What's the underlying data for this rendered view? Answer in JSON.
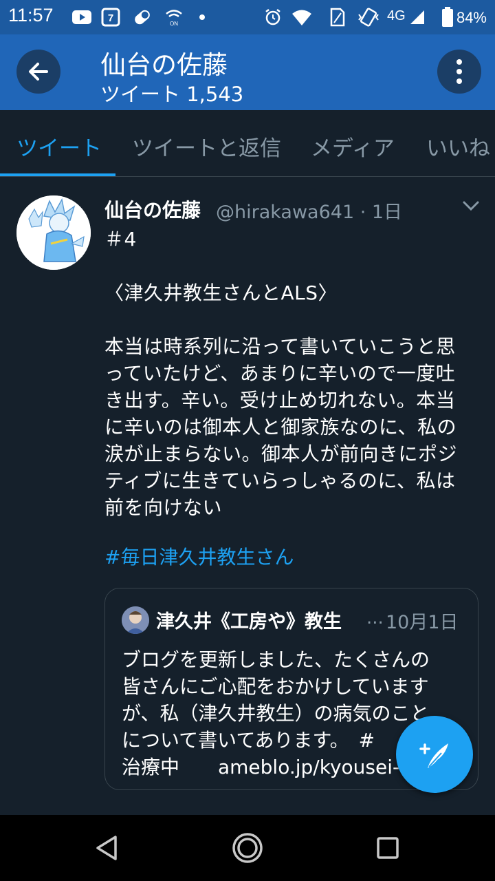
{
  "status_bar": {
    "time": "11:57",
    "network": "4G",
    "battery": "84%",
    "icons": [
      "youtube-icon",
      "seven-eleven-icon",
      "pill-icon",
      "wifi-on-icon",
      "dot-icon",
      "alarm-icon",
      "wifi-icon",
      "sim-icon",
      "vibrate-icon",
      "signal-icon",
      "battery-icon"
    ]
  },
  "header": {
    "title": "仙台の佐藤",
    "subtitle": "ツイート 1,543",
    "color": "#2066b8"
  },
  "tabs": [
    {
      "label": "ツイート",
      "active": true
    },
    {
      "label": "ツイートと返信",
      "active": false
    },
    {
      "label": "メディア",
      "active": false
    },
    {
      "label": "いいね",
      "active": false
    }
  ],
  "tweet": {
    "name": "仙台の佐藤",
    "meta": "@hirakawa641 · 1日",
    "lines": [
      "＃4",
      "",
      "〈津久井教生さんとALS〉",
      "",
      "本当は時系列に沿って書いていこうと思",
      "っていたけど、あまりに辛いので一度吐",
      "き出す。辛い。受け止め切れない。本当",
      "に辛いのは御本人と御家族なのに、私の",
      "涙が止まらない。御本人が前向きにポジ",
      "ティブに生きていらっしゃるのに、私は",
      "前を向けない"
    ],
    "hashtag": "#毎日津久井教生さん",
    "quote": {
      "name": "津久井《工房や》教生",
      "ellipsis": "...",
      "date": "10月1日",
      "lines": [
        "ブログを更新しました、たくさんの",
        "皆さんにご心配をおかけしています",
        "が、私（津久井教生）の病気のこと",
        "について書いてあります。　#",
        "治療中　　ameblo.jp/kyousei-"
      ]
    }
  },
  "accent_color": "#1da1f2",
  "background_color": "#15202b"
}
